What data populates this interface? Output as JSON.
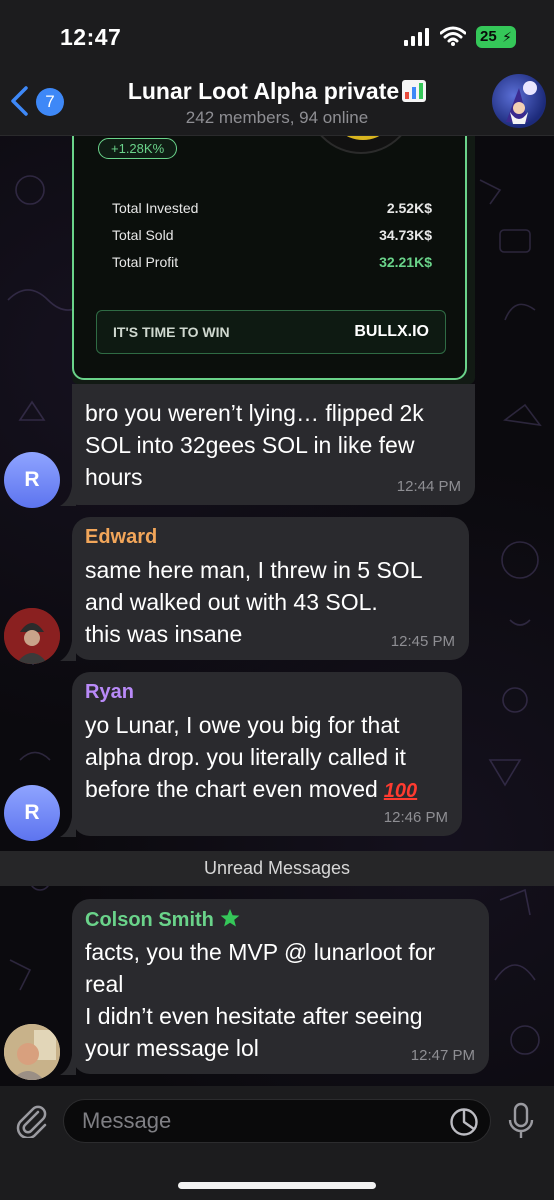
{
  "status_bar": {
    "time": "12:47",
    "battery": "25"
  },
  "header": {
    "back_count": "7",
    "title": "Lunar Loot Alpha private",
    "subtitle": "242 members, 94 online"
  },
  "card": {
    "pill": "+1.28K%",
    "stats": [
      {
        "label": "Total Invested",
        "value": "2.52K$"
      },
      {
        "label": "Total Sold",
        "value": "34.73K$"
      },
      {
        "label": "Total Profit",
        "value": "32.21K$"
      }
    ],
    "banner_left": "IT'S TIME TO WIN",
    "banner_right": "BULLX.IO"
  },
  "messages": [
    {
      "sender": "",
      "text": "bro you weren’t lying… flipped 2k\nSOL into 32gees SOL in like few\nhours",
      "time": "12:44 PM",
      "avatar": "R"
    },
    {
      "sender": "Edward",
      "text": "same here man, I threw in 5 SOL\nand walked out with 43 SOL.\nthis was insane",
      "time": "12:45 PM"
    },
    {
      "sender": "Ryan",
      "text": "yo Lunar, I owe you big for that\nalpha drop. you literally called it\nbefore the chart even moved",
      "time": "12:46 PM",
      "avatar": "R"
    },
    {
      "sender": "Colson Smith",
      "text": "facts, you the MVP @ lunarloot for\nreal\nI didn’t even hesitate after seeing\nyour message lol",
      "time": "12:47 PM"
    }
  ],
  "unread_divider": "Unread Messages",
  "composer": {
    "placeholder": "Message"
  },
  "colors": {
    "accent": "#3e88f7",
    "edward": "#f2a65a",
    "ryan": "#b98af8",
    "colson": "#6ad38a",
    "bubble": "#2a2a2e"
  }
}
